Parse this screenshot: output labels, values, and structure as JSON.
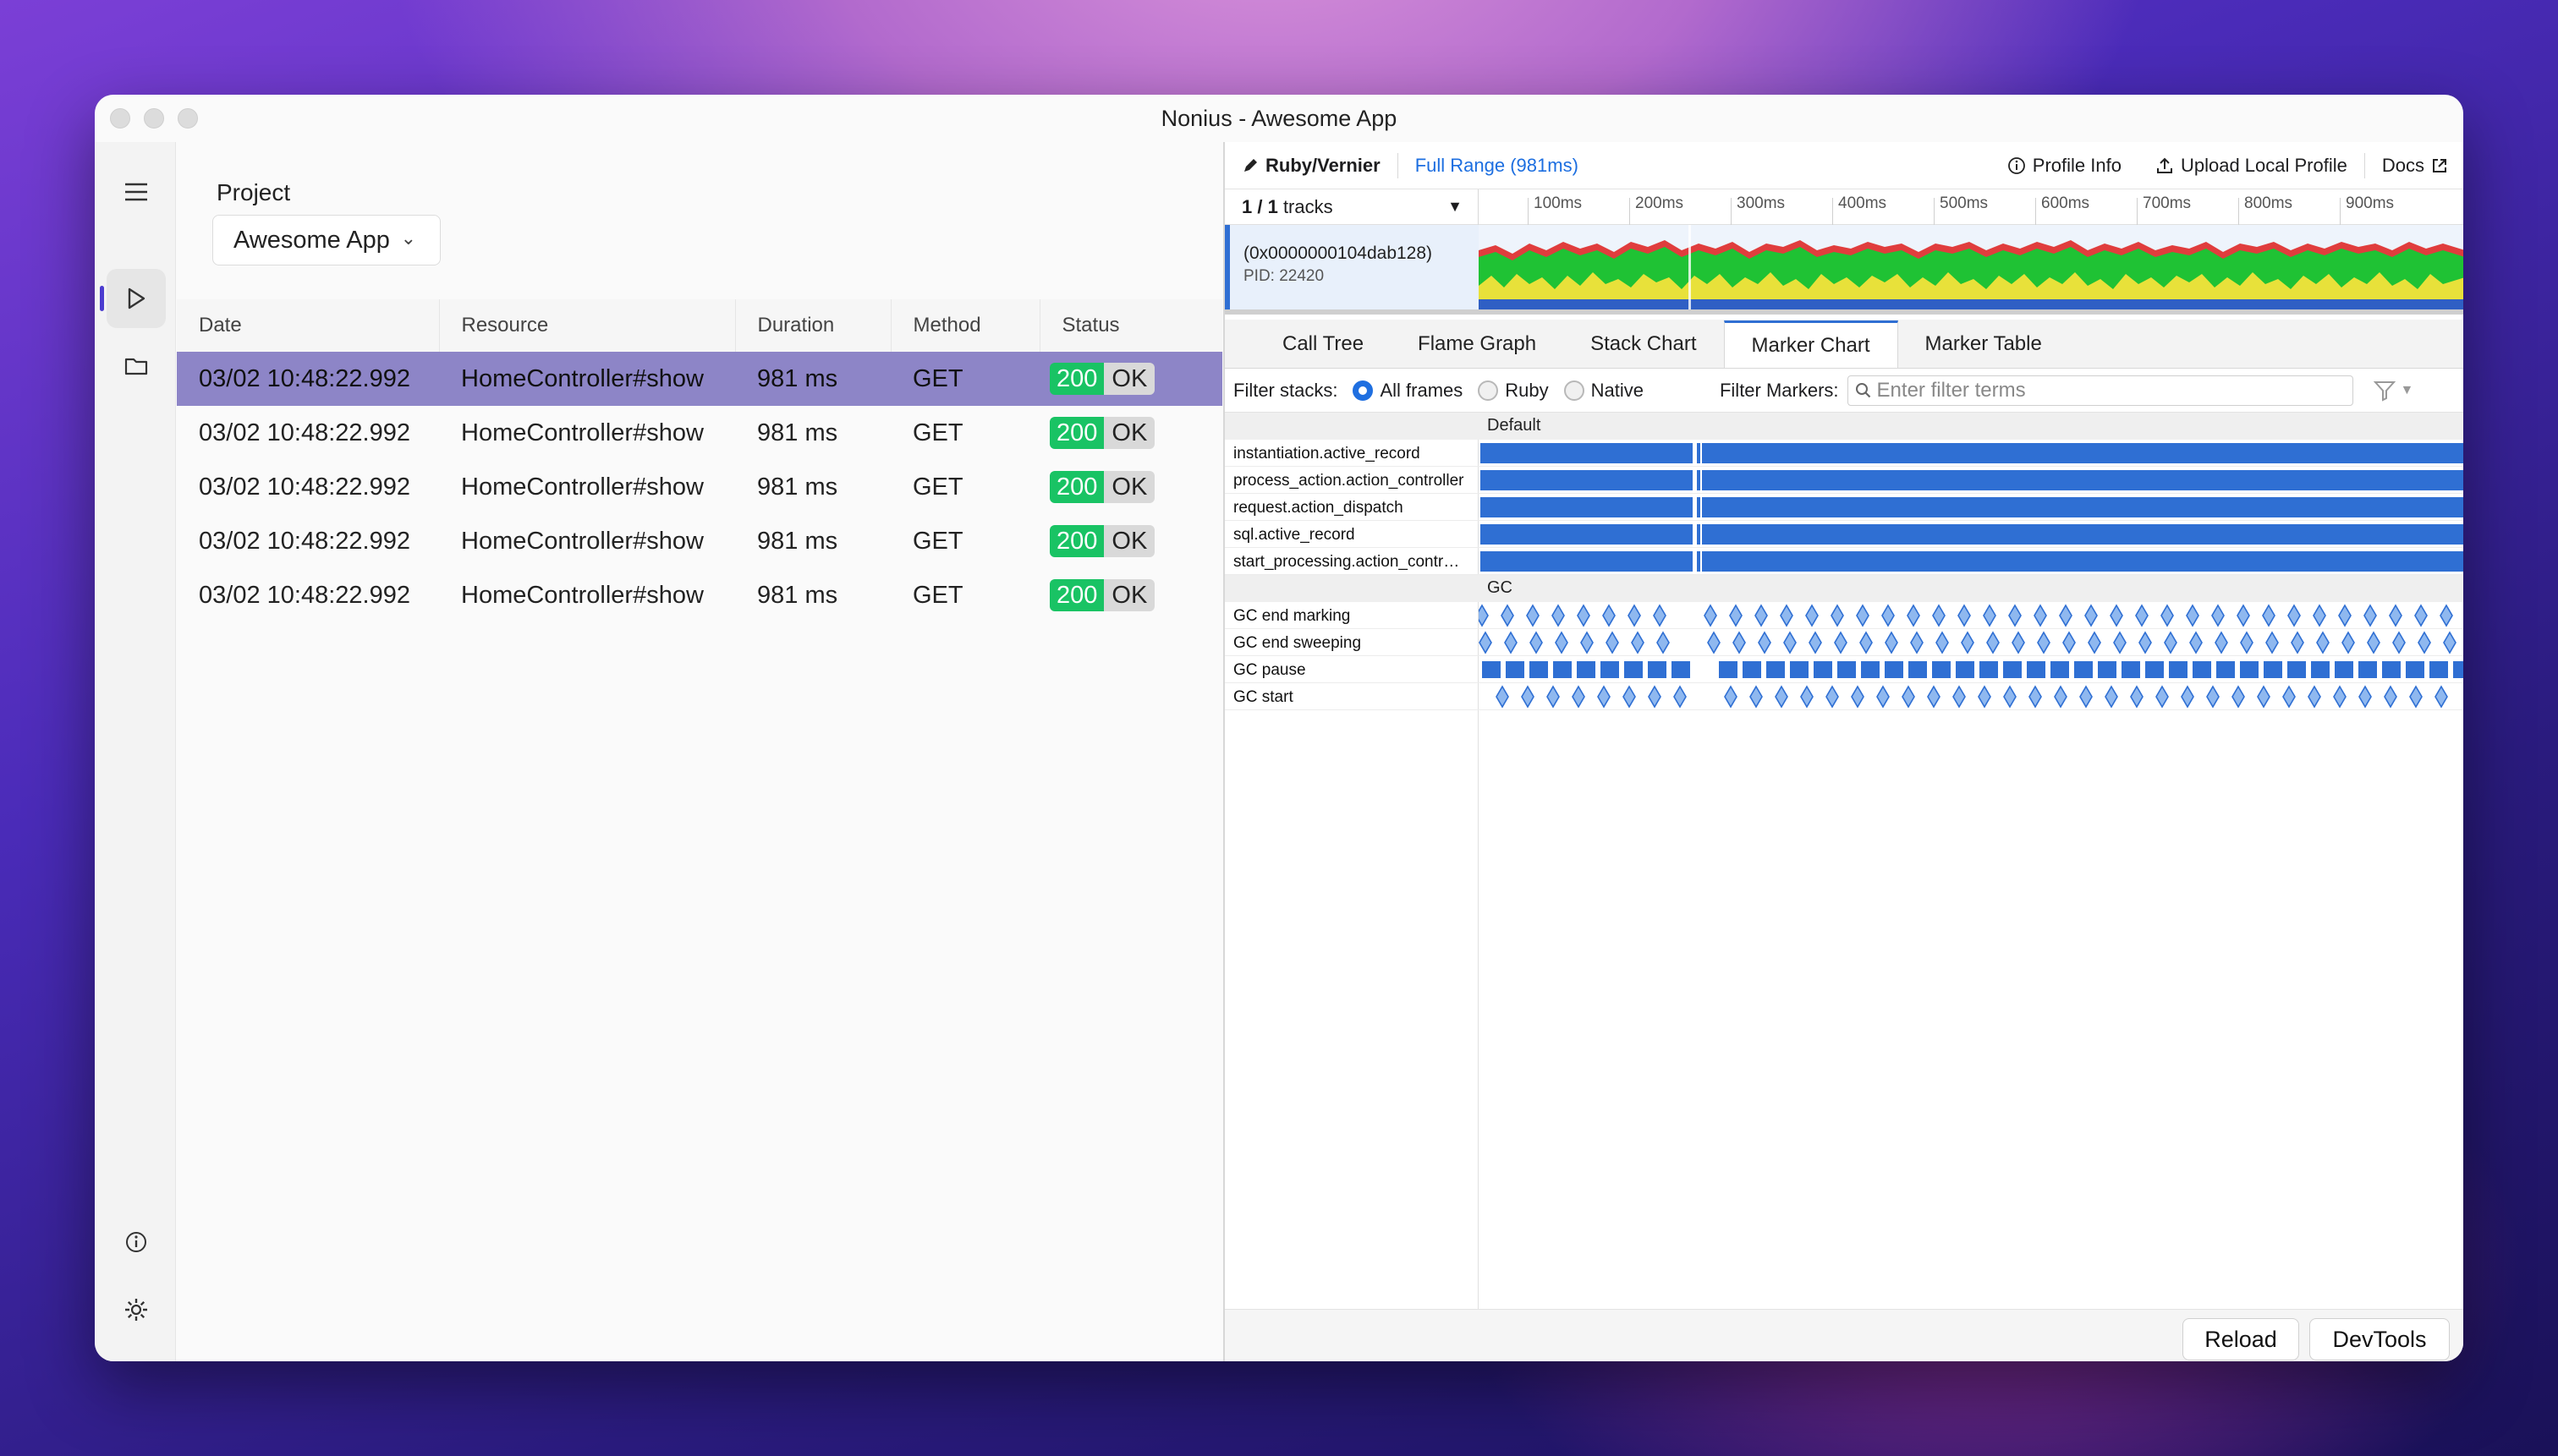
{
  "window": {
    "title": "Nonius - Awesome App"
  },
  "sidebar": {
    "icons": [
      "menu-icon",
      "play-icon",
      "folder-icon",
      "info-icon",
      "gear-icon"
    ]
  },
  "project": {
    "label": "Project",
    "selected": "Awesome App"
  },
  "requests": {
    "columns": [
      "Date",
      "Resource",
      "Duration",
      "Method",
      "Status"
    ],
    "rows": [
      {
        "date": "03/02 10:48:22.992",
        "resource": "HomeController#show",
        "duration": "981 ms",
        "method": "GET",
        "code": "200",
        "status": "OK"
      },
      {
        "date": "03/02 10:48:22.992",
        "resource": "HomeController#show",
        "duration": "981 ms",
        "method": "GET",
        "code": "200",
        "status": "OK"
      },
      {
        "date": "03/02 10:48:22.992",
        "resource": "HomeController#show",
        "duration": "981 ms",
        "method": "GET",
        "code": "200",
        "status": "OK"
      },
      {
        "date": "03/02 10:48:22.992",
        "resource": "HomeController#show",
        "duration": "981 ms",
        "method": "GET",
        "code": "200",
        "status": "OK"
      },
      {
        "date": "03/02 10:48:22.992",
        "resource": "HomeController#show",
        "duration": "981 ms",
        "method": "GET",
        "code": "200",
        "status": "OK"
      }
    ]
  },
  "profiler": {
    "profile_name": "Ruby/Vernier",
    "range": "Full Range (981ms)",
    "profile_info": "Profile Info",
    "upload": "Upload Local Profile",
    "docs": "Docs",
    "tracks_count": "1 / 1",
    "tracks_word": "tracks",
    "ticks": [
      "100ms",
      "200ms",
      "300ms",
      "400ms",
      "500ms",
      "600ms",
      "700ms",
      "800ms",
      "900ms"
    ],
    "thread_name": "(0x0000000104dab128)",
    "pid": "PID: 22420",
    "tabs": [
      "Call Tree",
      "Flame Graph",
      "Stack Chart",
      "Marker Chart",
      "Marker Table"
    ],
    "active_tab": "Marker Chart",
    "filter_stacks_label": "Filter stacks:",
    "filter_options": [
      "All frames",
      "Ruby",
      "Native"
    ],
    "filter_markers_label": "Filter Markers:",
    "filter_placeholder": "Enter filter terms",
    "groups": [
      {
        "name": "Default",
        "rows": [
          "instantiation.active_record",
          "process_action.action_controller",
          "request.action_dispatch",
          "sql.active_record",
          "start_processing.action_contr…"
        ]
      },
      {
        "name": "GC",
        "rows": [
          "GC end marking",
          "GC end sweeping",
          "GC pause",
          "GC start"
        ]
      }
    ],
    "buttons": {
      "reload": "Reload",
      "devtools": "DevTools"
    }
  },
  "colors": {
    "accent": "#4b3ccf",
    "selected_row": "#8d85c7",
    "status_green": "#19c364",
    "marker_blue": "#2f6fd3",
    "link": "#1c6ee0"
  }
}
